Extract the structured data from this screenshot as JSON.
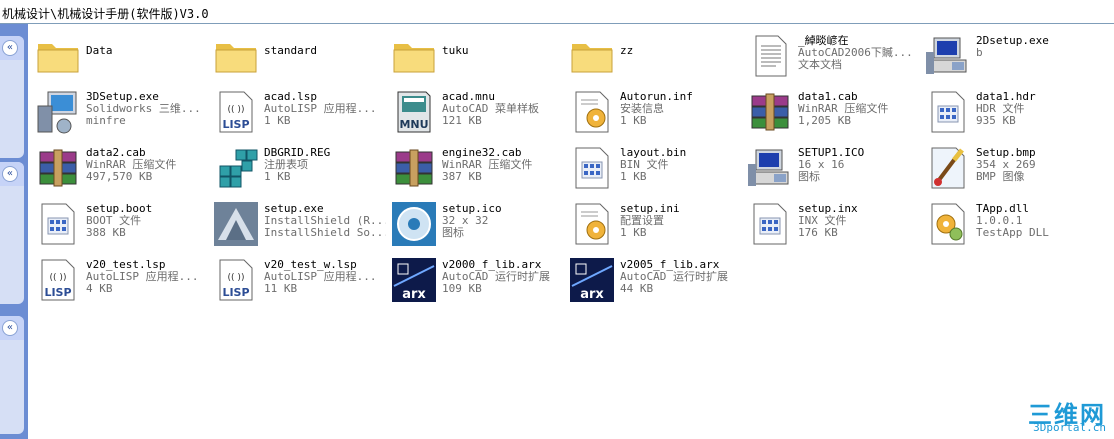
{
  "window": {
    "title": "机械设计\\机械设计手册(软件版)V3.0"
  },
  "sidebar": {
    "collapse_glyph": "«"
  },
  "files": [
    {
      "name": "Data",
      "type": "",
      "size": "",
      "icon": "folder-icon"
    },
    {
      "name": "standard",
      "type": "",
      "size": "",
      "icon": "folder-icon"
    },
    {
      "name": "tuku",
      "type": "",
      "size": "",
      "icon": "folder-icon"
    },
    {
      "name": "zz",
      "type": "",
      "size": "",
      "icon": "folder-icon"
    },
    {
      "name": "_綽晱嵃在",
      "type": "AutoCAD2006下贓...",
      "size": "文本文档",
      "icon": "text-document-icon"
    },
    {
      "name": "2Dsetup.exe",
      "type": "b",
      "size": "",
      "icon": "setup-computer-icon"
    },
    {
      "name": "3DSetup.exe",
      "type": "Solidworks 三维...",
      "size": "minfre",
      "icon": "setup-monitor-icon"
    },
    {
      "name": "acad.lsp",
      "type": "AutoLISP 应用程...",
      "size": "1 KB",
      "icon": "lisp-file-icon"
    },
    {
      "name": "acad.mnu",
      "type": "AutoCAD 菜单样板",
      "size": "121 KB",
      "icon": "mnu-file-icon"
    },
    {
      "name": "Autorun.inf",
      "type": "安装信息",
      "size": "1 KB",
      "icon": "config-gear-icon"
    },
    {
      "name": "data1.cab",
      "type": "WinRAR 压缩文件",
      "size": "1,205 KB",
      "icon": "winrar-archive-icon"
    },
    {
      "name": "data1.hdr",
      "type": "HDR 文件",
      "size": "935 KB",
      "icon": "generic-file-icon"
    },
    {
      "name": "data2.cab",
      "type": "WinRAR 压缩文件",
      "size": "497,570 KB",
      "icon": "winrar-archive-icon"
    },
    {
      "name": "DBGRID.REG",
      "type": "注册表项",
      "size": "1 KB",
      "icon": "registry-icon"
    },
    {
      "name": "engine32.cab",
      "type": "WinRAR 压缩文件",
      "size": "387 KB",
      "icon": "winrar-archive-icon"
    },
    {
      "name": "layout.bin",
      "type": "BIN 文件",
      "size": "1 KB",
      "icon": "generic-file-icon"
    },
    {
      "name": "SETUP1.ICO",
      "type": "16 x 16",
      "size": "图标",
      "icon": "setup-computer-icon"
    },
    {
      "name": "Setup.bmp",
      "type": "354 x 269",
      "size": "BMP 图像",
      "icon": "bitmap-brush-icon"
    },
    {
      "name": "setup.boot",
      "type": "BOOT 文件",
      "size": "388 KB",
      "icon": "generic-file-icon"
    },
    {
      "name": "setup.exe",
      "type": "InstallShield (R...",
      "size": "InstallShield So...",
      "icon": "installshield-icon"
    },
    {
      "name": "setup.ico",
      "type": "32 x 32",
      "size": "图标",
      "icon": "installer-disc-icon"
    },
    {
      "name": "setup.ini",
      "type": "配置设置",
      "size": "1 KB",
      "icon": "config-gear-icon"
    },
    {
      "name": "setup.inx",
      "type": "INX 文件",
      "size": "176 KB",
      "icon": "generic-file-icon"
    },
    {
      "name": "TApp.dll",
      "type": "1.0.0.1",
      "size": "TestApp DLL",
      "icon": "dll-gear-icon"
    },
    {
      "name": "v20_test.lsp",
      "type": "AutoLISP 应用程...",
      "size": "4 KB",
      "icon": "lisp-file-icon"
    },
    {
      "name": "v20_test_w.lsp",
      "type": "AutoLISP 应用程...",
      "size": "11 KB",
      "icon": "lisp-file-icon"
    },
    {
      "name": "v2000_f_lib.arx",
      "type": "AutoCAD 运行时扩展",
      "size": "109 KB",
      "icon": "arx-file-icon"
    },
    {
      "name": "v2005_f_lib.arx",
      "type": "AutoCAD 运行时扩展",
      "size": "44 KB",
      "icon": "arx-file-icon"
    }
  ],
  "watermark": {
    "logo_text": "三维网",
    "url": "3Dportal.cn"
  },
  "colors": {
    "sidebar": "#6c8dd3",
    "folder": "#f5d66e",
    "watermark": "#1f9ad6"
  }
}
